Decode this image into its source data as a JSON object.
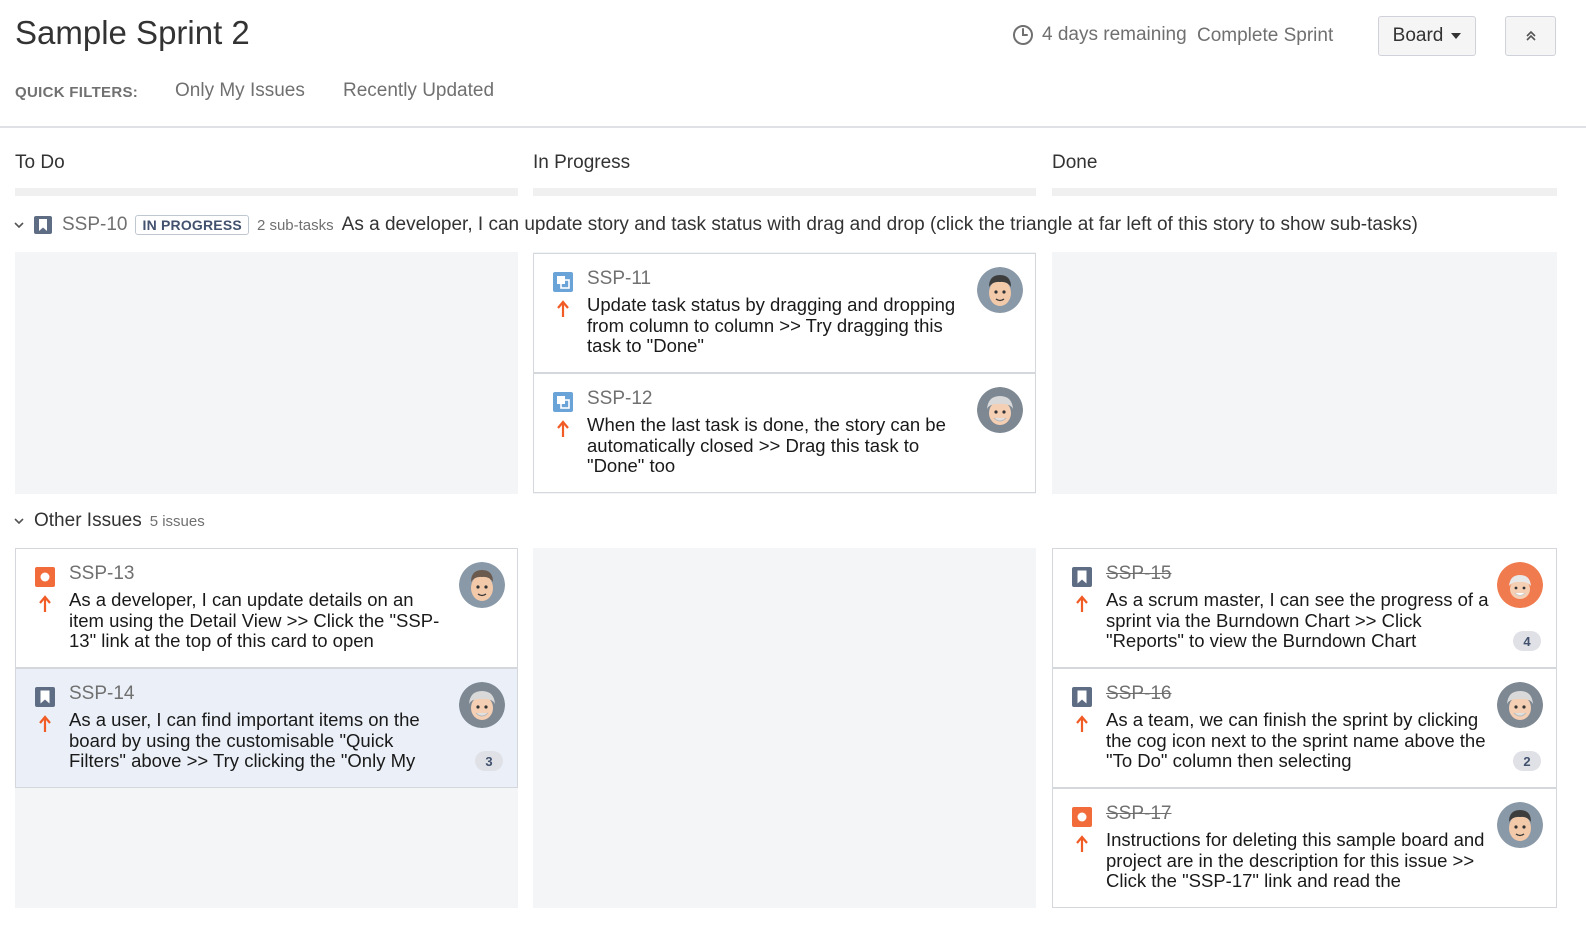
{
  "header": {
    "title": "Sample Sprint 2",
    "remaining": "4 days remaining",
    "complete_sprint": "Complete Sprint",
    "board_label": "Board"
  },
  "quick_filters": {
    "label": "QUICK FILTERS:",
    "items": [
      "Only My Issues",
      "Recently Updated"
    ]
  },
  "columns": [
    "To Do",
    "In Progress",
    "Done"
  ],
  "swimlane": {
    "key": "SSP-10",
    "status": "IN PROGRESS",
    "subtasks": "2 sub-tasks",
    "summary": "As a developer, I can update story and task status with drag and drop (click the triangle at far left of this story to show sub-tasks)"
  },
  "swimlane_cards": [
    {
      "key": "SSP-11",
      "summary": "Update task status by dragging and dropping from column to column >> Try dragging this task to \"Done\""
    },
    {
      "key": "SSP-12",
      "summary": "When the last task is done, the story can be automatically closed >> Drag this task to \"Done\" too"
    }
  ],
  "other_issues": {
    "title": "Other Issues",
    "count": "5 issues"
  },
  "todo_cards": [
    {
      "key": "SSP-13",
      "summary": "As a developer, I can update details on an item using the Detail View >> Click the \"SSP-13\" link at the top of this card to open"
    },
    {
      "key": "SSP-14",
      "summary": "As a user, I can find important items on the board by using the customisable \"Quick Filters\" above >> Try clicking the \"Only My",
      "badge": "3"
    }
  ],
  "done_cards": [
    {
      "key": "SSP-15",
      "summary": "As a scrum master, I can see the progress of a sprint via the Burndown Chart >> Click \"Reports\" to view the Burndown Chart",
      "badge": "4"
    },
    {
      "key": "SSP-16",
      "summary": "As a team, we can finish the sprint by clicking the cog icon next to the sprint name above the \"To Do\" column then selecting",
      "badge": "2"
    },
    {
      "key": "SSP-17",
      "summary": "Instructions for deleting this sample board and project are in the description for this issue >> Click the \"SSP-17\" link and read the"
    }
  ],
  "icons": {
    "clock": "clock-icon",
    "collapse": "double-chevron-up-icon",
    "story": "story-bookmark-icon",
    "subtask": "subtask-icon",
    "bug": "bug-icon",
    "priority": "priority-high-arrow-icon"
  },
  "colors": {
    "priority": "#f15c26",
    "bug": "#f26b3a",
    "story_icon": "#5e6c84",
    "subtask_icon": "#6aa3d8",
    "cell_bg": "#f4f5f7",
    "selected_card": "#ebf0f8"
  }
}
